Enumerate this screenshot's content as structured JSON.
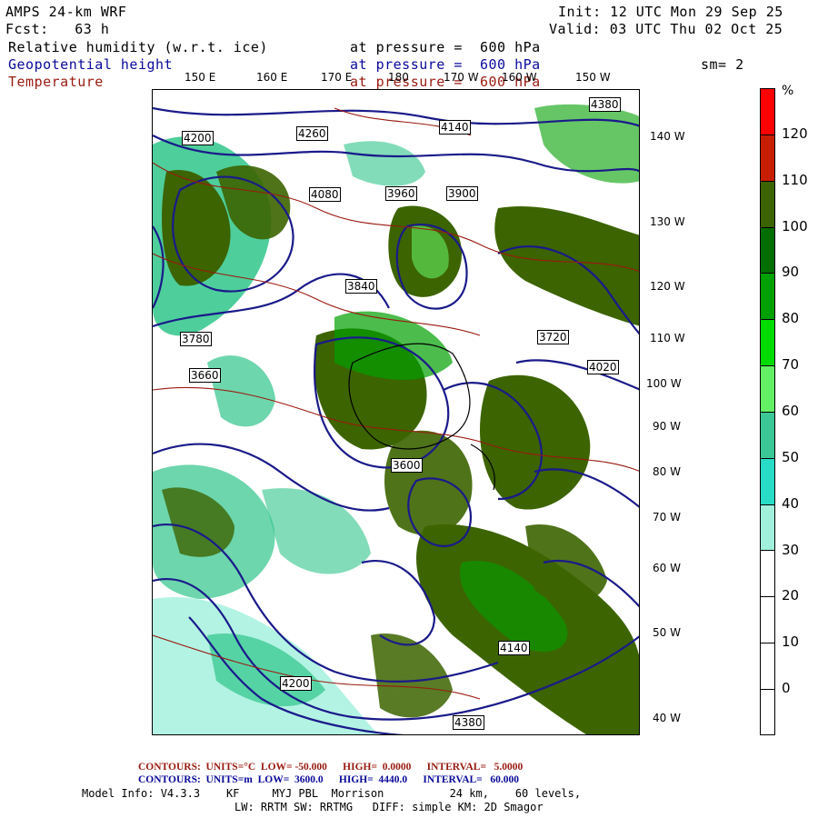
{
  "header": {
    "model": "AMPS 24-km WRF",
    "forecast": "Fcst:   63 h",
    "init": "Init: 12 UTC Mon 29 Sep 25",
    "valid": "Valid: 03 UTC Thu 02 Oct 25"
  },
  "fields": [
    {
      "name": "Relative humidity (w.r.t. ice)",
      "level": "at pressure =  600 hPa",
      "color": "#000000"
    },
    {
      "name": "Geopotential height",
      "level": "at pressure =  600 hPa",
      "color": "#0a0a9a"
    },
    {
      "name": "Temperature",
      "level": "at pressure =  600 hPa",
      "color": "#9a1a10"
    }
  ],
  "smoothing": "sm= 2",
  "longitude_labels_top": [
    "150 E",
    "160 E",
    "170 E",
    "180",
    "170 W",
    "160 W",
    "150 W"
  ],
  "longitude_labels_right": [
    "140 W",
    "130 W",
    "120 W",
    "110 W",
    "100 W",
    "90 W",
    "80 W",
    "70 W",
    "60 W",
    "50 W",
    "40 W"
  ],
  "height_contour_labels": [
    "4380",
    "4260",
    "4200",
    "4140",
    "4080",
    "3960",
    "3900",
    "3840",
    "3780",
    "3720",
    "3660",
    "3600",
    "4020"
  ],
  "colorbar": {
    "unit": "%",
    "ticks": [
      "120",
      "110",
      "100",
      "90",
      "80",
      "70",
      "60",
      "50",
      "40",
      "30",
      "20",
      "10",
      "0"
    ],
    "colors": [
      "#ff0000",
      "#c81e00",
      "#3c6400",
      "#006e00",
      "#00a000",
      "#00dc00",
      "#64f064",
      "#3cc896",
      "#28dcc8",
      "#a0f0dc",
      "#ffffff",
      "#ffffff",
      "#ffffff",
      "#ffffff"
    ]
  },
  "footer": {
    "temp_contours": "CONTOURS:  UNITS=°C  LOW= -50.000      HIGH=  0.0000      INTERVAL=   5.0000",
    "height_contours": "CONTOURS:  UNITS=m  LOW=  3600.0      HIGH=  4440.0      INTERVAL=   60.000",
    "model_info": "Model Info: V4.3.3    KF     MYJ PBL  Morrison          24 km,    60 levels,",
    "model_info2": "LW: RRTM SW: RRTMG   DIFF: simple KM: 2D Smagor"
  }
}
